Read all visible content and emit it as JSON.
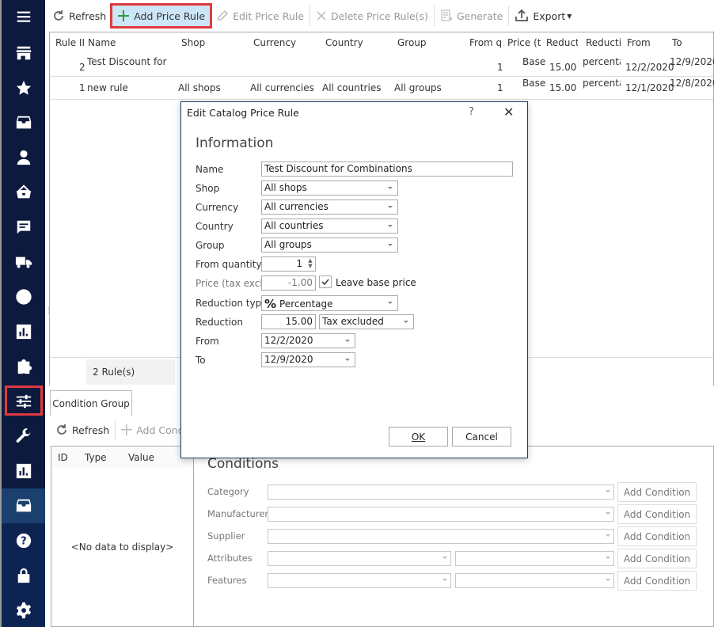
{
  "sidebar": {
    "items": [
      {
        "icon": "menu-icon"
      },
      {
        "icon": "store-icon"
      },
      {
        "icon": "star-icon"
      },
      {
        "icon": "archive-icon"
      },
      {
        "icon": "user-icon"
      },
      {
        "icon": "basket-icon"
      },
      {
        "icon": "message-icon"
      },
      {
        "icon": "truck-icon"
      },
      {
        "icon": "globe-icon"
      },
      {
        "icon": "chart-icon"
      },
      {
        "icon": "puzzle-icon"
      },
      {
        "icon": "sliders-icon",
        "highlighted": true
      },
      {
        "icon": "wrench-icon"
      },
      {
        "icon": "chart-icon"
      },
      {
        "icon": "archive-icon",
        "active": true
      },
      {
        "icon": "help-icon"
      },
      {
        "icon": "lock-icon"
      },
      {
        "icon": "gear-icon"
      }
    ]
  },
  "toolbar": {
    "refresh": "Refresh",
    "add": "Add Price Rule",
    "edit": "Edit Price Rule",
    "delete": "Delete Price Rule(s)",
    "generate": "Generate",
    "export": "Export"
  },
  "grid": {
    "columns": [
      "Rule II",
      "Name",
      "Shop",
      "Currency",
      "Country",
      "Group",
      "From q",
      "Price (ta",
      "Reduct",
      "Reducti",
      "From",
      "To"
    ],
    "rows": [
      {
        "id": "2",
        "name": "Test Discount for",
        "shop": "",
        "currency": "",
        "country": "",
        "group": "",
        "from_qty": "1",
        "price": "Base",
        "reduction": "15.00",
        "reduction_type": "percenta",
        "from": "12/2/2020",
        "to": "12/9/2020"
      },
      {
        "id": "1",
        "name": "new rule",
        "shop": "All shops",
        "currency": "All currencies",
        "country": "All countries",
        "group": "All groups",
        "from_qty": "1",
        "price": "Base",
        "reduction": "15.00",
        "reduction_type": "percenta",
        "from": "12/1/2020",
        "to": "12/8/2020"
      }
    ],
    "footer_count": "2 Rule(s)"
  },
  "condition_group": {
    "tab": "Condition Group",
    "refresh": "Refresh",
    "add": "Add Conditi",
    "columns": [
      "ID",
      "Type",
      "Value"
    ],
    "empty": "<No data to display>"
  },
  "conditions": {
    "title": "Conditions",
    "rows": [
      {
        "label": "Category",
        "button": "Add Condition"
      },
      {
        "label": "Manufacturer",
        "button": "Add Condition"
      },
      {
        "label": "Supplier",
        "button": "Add Condition"
      },
      {
        "label": "Attributes",
        "button": "Add Condition"
      },
      {
        "label": "Features",
        "button": "Add Condition"
      }
    ]
  },
  "dialog": {
    "title": "Edit Catalog Price Rule",
    "help": "?",
    "heading": "Information",
    "labels": {
      "name": "Name",
      "shop": "Shop",
      "currency": "Currency",
      "country": "Country",
      "group": "Group",
      "from_qty": "From quantity",
      "price": "Price (tax excl.)",
      "reduction_type": "Reduction type",
      "reduction": "Reduction",
      "from": "From",
      "to": "To"
    },
    "values": {
      "name": "Test Discount for Combinations",
      "shop": "All shops",
      "currency": "All currencies",
      "country": "All countries",
      "group": "All groups",
      "from_qty": "1",
      "price": "-1.00",
      "leave_base_price": "Leave base price",
      "leave_base_price_checked": true,
      "reduction_type": "Percentage",
      "reduction": "15.00",
      "tax": "Tax excluded",
      "from": "12/2/2020",
      "to": "12/9/2020"
    },
    "ok": "OK",
    "cancel": "Cancel"
  }
}
